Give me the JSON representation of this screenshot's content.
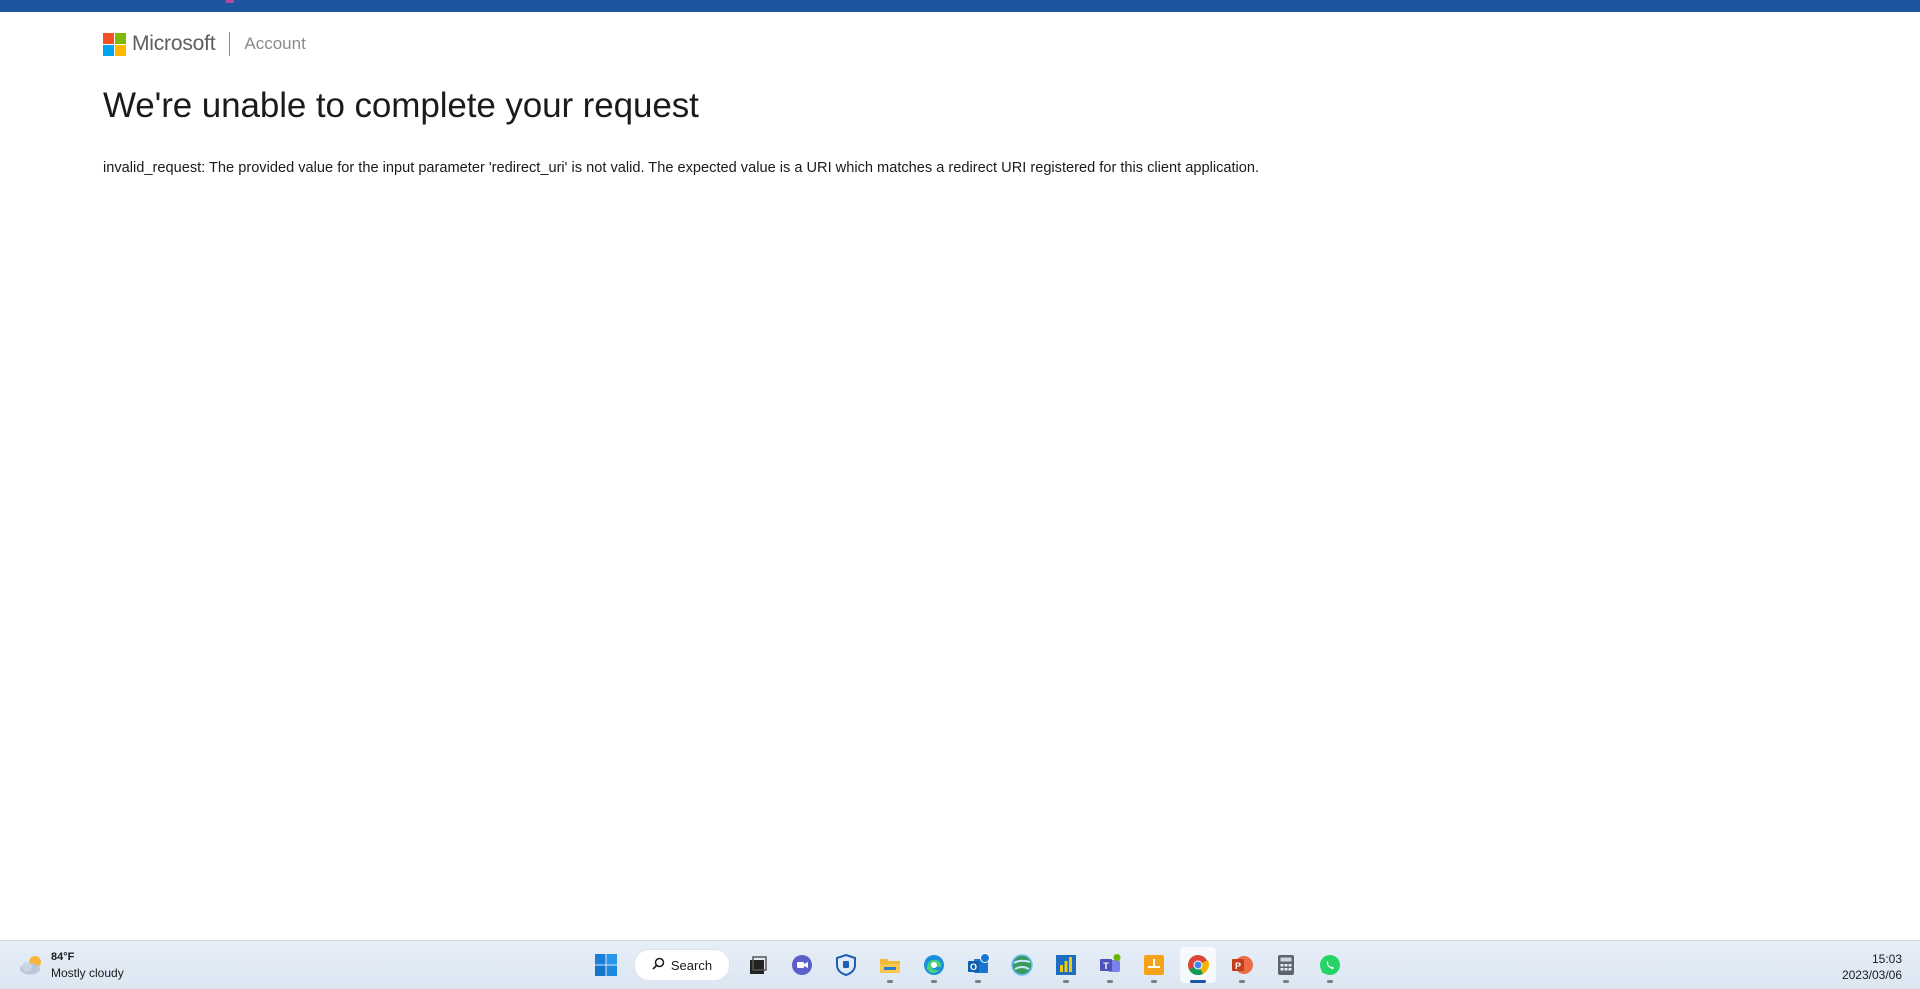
{
  "header": {
    "brand": "Microsoft",
    "section": "Account"
  },
  "page": {
    "title": "We're unable to complete your request",
    "message": "invalid_request: The provided value for the input parameter 'redirect_uri' is not valid. The expected value is a URI which matches a redirect URI registered for this client application."
  },
  "colors": {
    "top_bar": "#1d56a0",
    "logo": [
      "#f25022",
      "#7fba00",
      "#00a4ef",
      "#ffb900"
    ]
  },
  "taskbar": {
    "weather": {
      "temperature": "84°F",
      "condition": "Mostly cloudy"
    },
    "search_label": "Search",
    "apps": [
      "start-icon",
      "search",
      "task-view-icon",
      "chat-icon",
      "security-icon",
      "file-explorer-icon",
      "edge-icon",
      "outlook-icon",
      "network-globe-icon",
      "power-bi-icon",
      "teams-icon",
      "orange-app-icon",
      "chrome-icon",
      "powerpoint-icon",
      "calculator-icon",
      "whatsapp-icon"
    ],
    "active_app": "chrome-icon",
    "clock": {
      "time": "15:03",
      "date": "2023/03/06"
    }
  }
}
